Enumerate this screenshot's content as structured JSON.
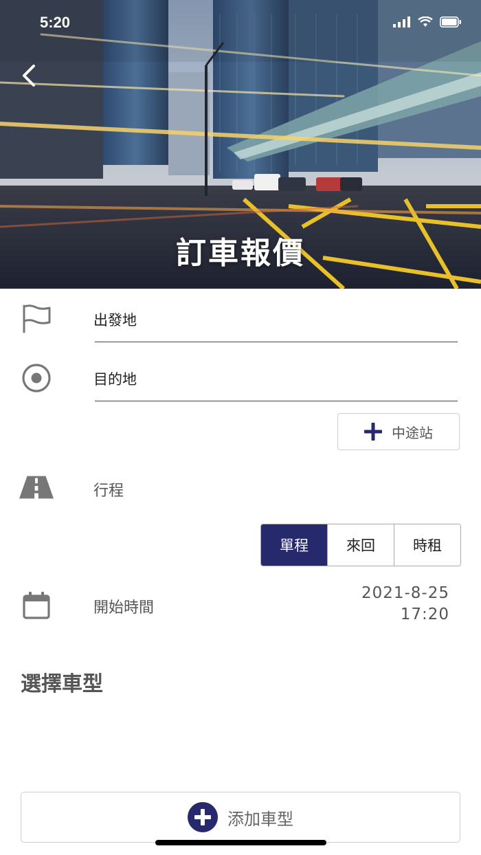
{
  "status_bar": {
    "time": "5:20"
  },
  "header": {
    "title": "訂車報價"
  },
  "form": {
    "origin": {
      "value": "出發地"
    },
    "destination": {
      "value": "目的地"
    },
    "waypoint_button": "中途站",
    "trip": {
      "label": "行程",
      "options": [
        "單程",
        "來回",
        "時租"
      ],
      "selected": "單程"
    },
    "start_time": {
      "label": "開始時間",
      "date": "2021-8-25",
      "time": "17:20"
    }
  },
  "vehicle": {
    "section_title": "選擇車型",
    "add_button": "添加車型"
  },
  "colors": {
    "accent": "#27296d",
    "icon_grey": "#777777"
  }
}
